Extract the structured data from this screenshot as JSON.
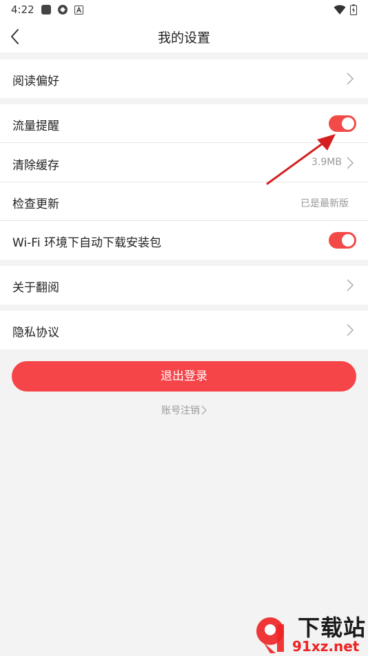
{
  "status_bar": {
    "time": "4:22"
  },
  "header": {
    "title": "我的设置"
  },
  "rows": {
    "reading_pref": {
      "label": "阅读偏好"
    },
    "data_reminder": {
      "label": "流量提醒",
      "toggle_on": true
    },
    "clear_cache": {
      "label": "清除缓存",
      "value": "3.9MB"
    },
    "check_update": {
      "label": "检查更新",
      "value": "已是最新版"
    },
    "wifi_download": {
      "label": "Wi-Fi 环境下自动下载安装包",
      "toggle_on": true
    },
    "about": {
      "label": "关于翻阅"
    },
    "privacy": {
      "label": "隐私协议"
    }
  },
  "logout_button": "退出登录",
  "account_cancel_link": "账号注销",
  "watermark": {
    "brand": "下载站",
    "url": "91xz.net"
  },
  "colors": {
    "accent": "#f24a47",
    "background": "#f3f3f3"
  }
}
